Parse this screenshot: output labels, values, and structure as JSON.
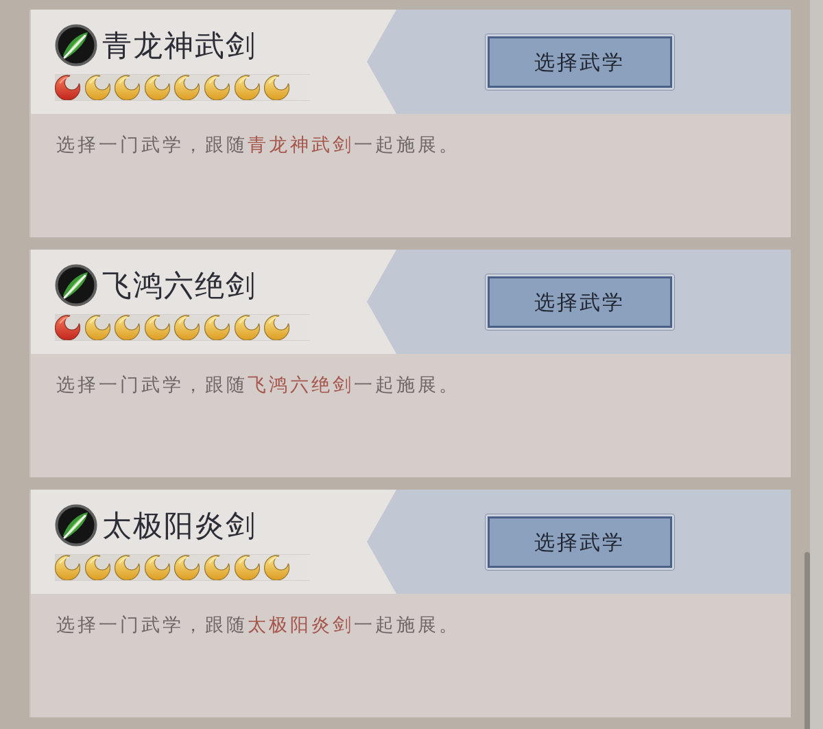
{
  "cards": [
    {
      "title": "青龙神武剑",
      "moons": [
        {
          "kind": "red"
        },
        {
          "kind": "gold"
        },
        {
          "kind": "gold"
        },
        {
          "kind": "gold"
        },
        {
          "kind": "gold"
        },
        {
          "kind": "gold"
        },
        {
          "kind": "gold"
        },
        {
          "kind": "gold"
        }
      ],
      "button": "选择武学",
      "description": [
        {
          "text": "选择一门武学，跟随",
          "highlight": false
        },
        {
          "text": "青龙神武剑",
          "highlight": true
        },
        {
          "text": "一起施展。",
          "highlight": false
        }
      ]
    },
    {
      "title": "飞鸿六绝剑",
      "moons": [
        {
          "kind": "red"
        },
        {
          "kind": "gold"
        },
        {
          "kind": "gold"
        },
        {
          "kind": "gold"
        },
        {
          "kind": "gold"
        },
        {
          "kind": "gold"
        },
        {
          "kind": "gold"
        },
        {
          "kind": "gold"
        }
      ],
      "button": "选择武学",
      "description": [
        {
          "text": "选择一门武学，跟随",
          "highlight": false
        },
        {
          "text": "飞鸿六绝剑",
          "highlight": true
        },
        {
          "text": "一起施展。",
          "highlight": false
        }
      ]
    },
    {
      "title": "太极阳炎剑",
      "moons": [
        {
          "kind": "gold"
        },
        {
          "kind": "gold"
        },
        {
          "kind": "gold"
        },
        {
          "kind": "gold"
        },
        {
          "kind": "gold"
        },
        {
          "kind": "gold"
        },
        {
          "kind": "gold"
        },
        {
          "kind": "gold"
        }
      ],
      "button": "选择武学",
      "description": [
        {
          "text": "选择一门武学，跟随",
          "highlight": false
        },
        {
          "text": "太极阳炎剑",
          "highlight": true
        },
        {
          "text": "一起施展。",
          "highlight": false
        }
      ]
    }
  ]
}
